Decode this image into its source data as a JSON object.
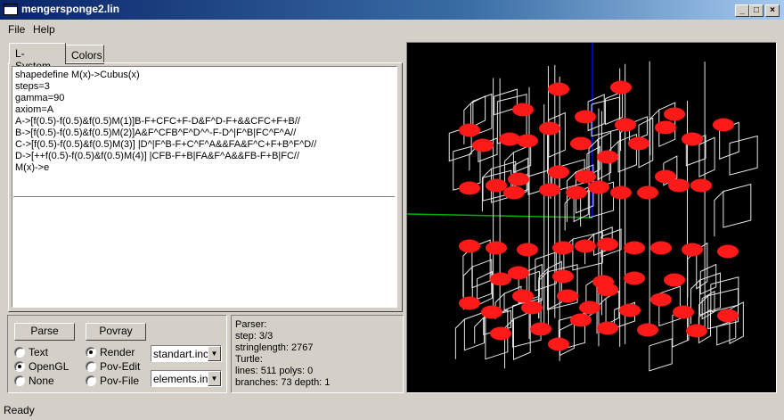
{
  "window": {
    "title": "mengersponge2.lin"
  },
  "menu": {
    "file": "File",
    "help": "Help"
  },
  "tabs": {
    "lsystem": "L-System",
    "colors": "Colors"
  },
  "editor": {
    "lines": [
      "shapedefine M(x)->Cubus(x)",
      "steps=3",
      "gamma=90",
      "axiom=A",
      "A->[f(0.5)-f(0.5)&f(0.5)M(1)]B-F+CFC+F-D&F^D-F+&&CFC+F+B//",
      "B->[f(0.5)-f(0.5)&f(0.5)M(2)]A&F^CFB^F^D^^-F-D^|F^B|FC^F^A//",
      "C->[f(0.5)-f(0.5)&f(0.5)M(3)] |D^|F^B-F+C^F^A&&FA&F^C+F+B^F^D//",
      "D->[++f(0.5)-f(0.5)&f(0.5)M(4)] |CFB-F+B|FA&F^A&&FB-F+B|FC//",
      "M(x)->e"
    ]
  },
  "controls": {
    "parse_label": "Parse",
    "povray_label": "Povray",
    "output_modes": [
      "Text",
      "OpenGL",
      "None"
    ],
    "output_selected": "OpenGL",
    "render_modes": [
      "Render",
      "Pov-Edit",
      "Pov-File"
    ],
    "render_selected": "Render",
    "combo1_value": "standart.inc",
    "combo2_value": "elements.inc"
  },
  "info": {
    "lines": [
      "Parser:",
      "step: 3/3",
      "stringlength: 2767",
      "Turtle:",
      "lines: 511 polys: 0",
      "branches: 73 depth: 1"
    ]
  },
  "status": {
    "text": "Ready"
  },
  "colors": {
    "viewport_bg": "#000000",
    "sphere": "#ff1a1a",
    "wire": "#e6e6e6",
    "axis_blue": "#0000ff",
    "axis_green": "#00b000"
  }
}
